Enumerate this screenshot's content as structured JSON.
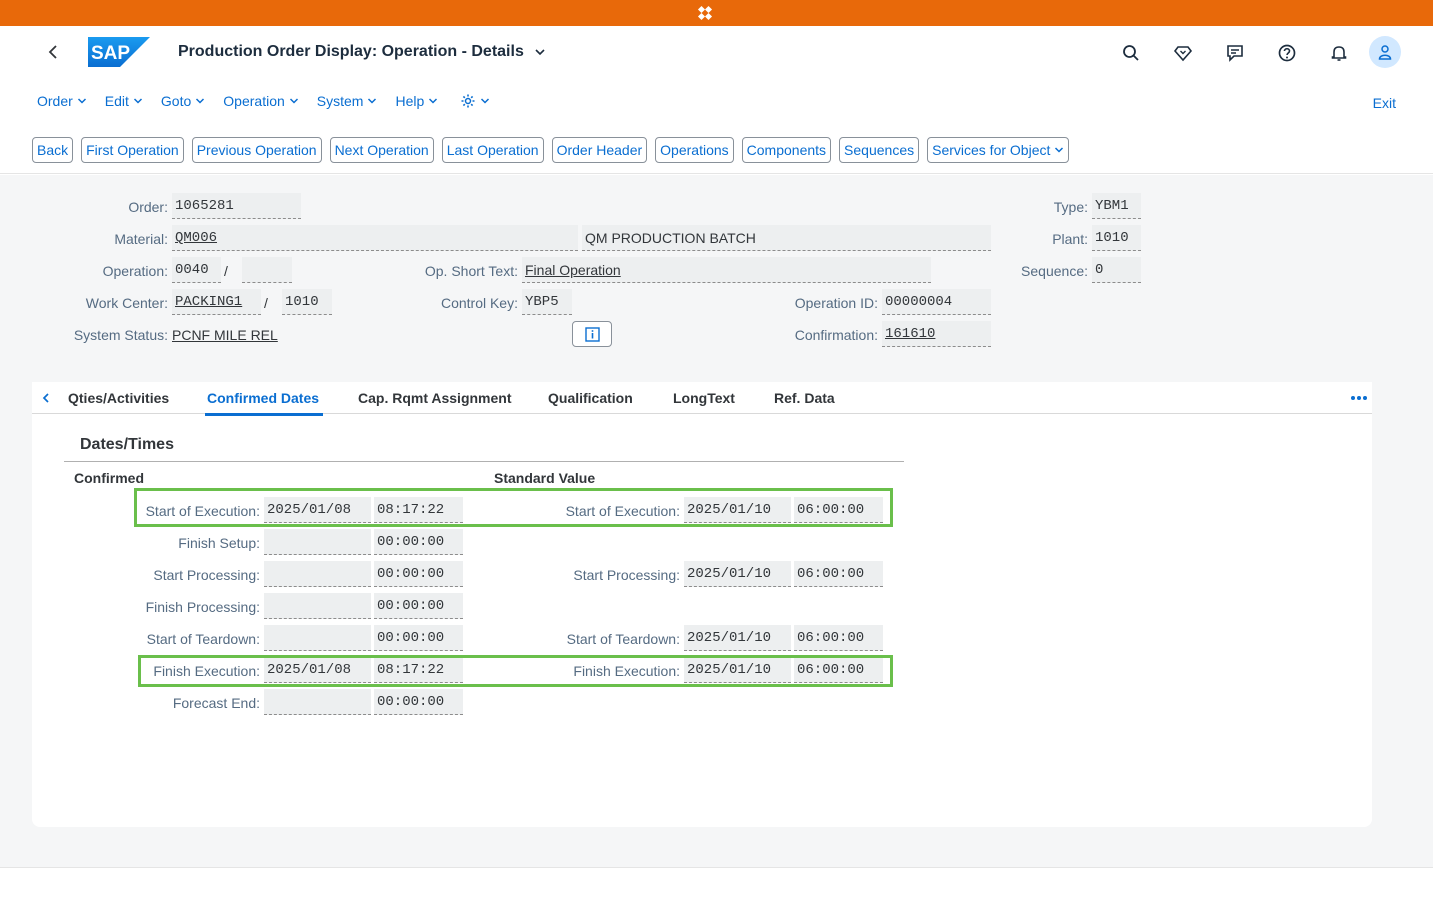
{
  "shell": {
    "title": "Production Order Display: Operation - Details",
    "colors": {
      "brand_orange": "#e8690a",
      "accent": "#0a6ed1",
      "highlight": "#6abf4b"
    }
  },
  "menu": {
    "items": [
      "Order",
      "Edit",
      "Goto",
      "Operation",
      "System",
      "Help"
    ],
    "exit": "Exit"
  },
  "toolbar": {
    "buttons": [
      "Back",
      "First Operation",
      "Previous Operation",
      "Next Operation",
      "Last Operation",
      "Order Header",
      "Operations",
      "Components",
      "Sequences",
      "Services for Object"
    ]
  },
  "header": {
    "order_label": "Order:",
    "order": "1065281",
    "type_label": "Type:",
    "type": "YBM1",
    "material_label": "Material:",
    "material": "QM006",
    "material_desc": "QM PRODUCTION BATCH",
    "plant_label": "Plant:",
    "plant": "1010",
    "operation_label": "Operation:",
    "operation": "0040",
    "operation_sep": "/",
    "operation_sub": "",
    "short_text_label": "Op. Short Text:",
    "short_text": "Final Operation",
    "sequence_label": "Sequence:",
    "sequence": "0",
    "work_center_label": "Work Center:",
    "work_center": "PACKING1",
    "work_center_sep": "/",
    "work_center_plant": "1010",
    "control_key_label": "Control Key:",
    "control_key": "YBP5",
    "operation_id_label": "Operation ID:",
    "operation_id": "00000004",
    "system_status_label": "System Status:",
    "system_status": "PCNF MILE REL",
    "confirmation_label": "Confirmation:",
    "confirmation": "161610"
  },
  "tabs": [
    "Qties/Activities",
    "Confirmed Dates",
    "Cap. Rqmt Assignment",
    "Qualification",
    "LongText",
    "Ref. Data"
  ],
  "dates": {
    "section_title": "Dates/Times",
    "confirmed_header": "Confirmed",
    "standard_header": "Standard Value",
    "rows": [
      {
        "label": "Start of Execution:",
        "c_date": "2025/01/08",
        "c_time": "08:17:22",
        "s_label": "Start of Execution:",
        "s_date": "2025/01/10",
        "s_time": "06:00:00"
      },
      {
        "label": "Finish Setup:",
        "c_date": "",
        "c_time": "00:00:00"
      },
      {
        "label": "Start Processing:",
        "c_date": "",
        "c_time": "00:00:00",
        "s_label": "Start Processing:",
        "s_date": "2025/01/10",
        "s_time": "06:00:00"
      },
      {
        "label": "Finish Processing:",
        "c_date": "",
        "c_time": "00:00:00"
      },
      {
        "label": "Start of Teardown:",
        "c_date": "",
        "c_time": "00:00:00",
        "s_label": "Start of Teardown:",
        "s_date": "2025/01/10",
        "s_time": "06:00:00"
      },
      {
        "label": "Finish Execution:",
        "c_date": "2025/01/08",
        "c_time": "08:17:22",
        "s_label": "Finish Execution:",
        "s_date": "2025/01/10",
        "s_time": "06:00:00"
      },
      {
        "label": "Forecast End:",
        "c_date": "",
        "c_time": "00:00:00"
      }
    ]
  }
}
